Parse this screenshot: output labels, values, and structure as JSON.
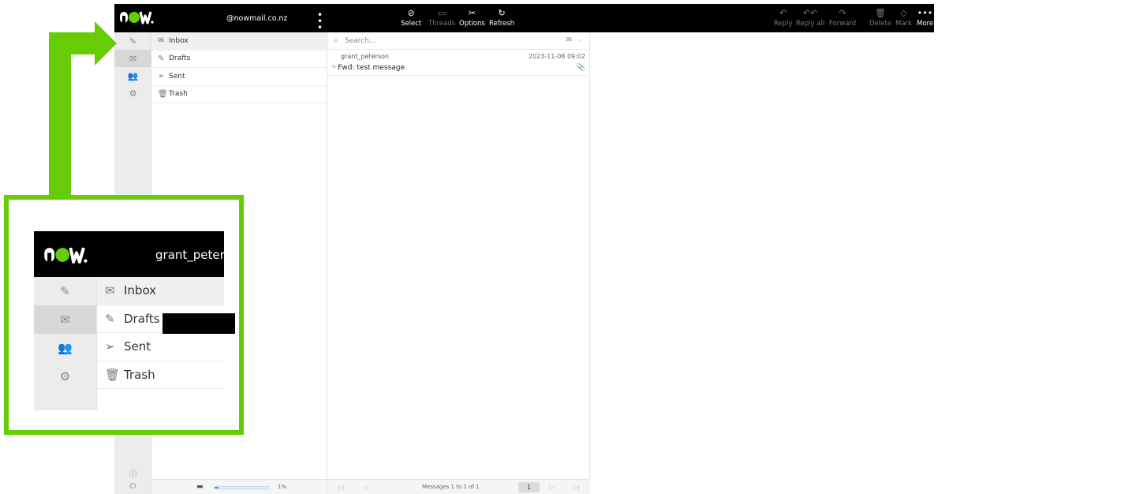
{
  "header": {
    "logo_text": "now.",
    "account_label": "@nowmail.co.nz",
    "more_menu_glyph": "⋮"
  },
  "toolbar_left": [
    {
      "id": "select",
      "label": "Select",
      "icon": "check-circle-icon",
      "enabled": true
    },
    {
      "id": "threads",
      "label": "Threads",
      "icon": "threads-icon",
      "enabled": false
    },
    {
      "id": "options",
      "label": "Options",
      "icon": "options-icon",
      "enabled": true
    },
    {
      "id": "refresh",
      "label": "Refresh",
      "icon": "refresh-icon",
      "enabled": true
    }
  ],
  "toolbar_right": [
    {
      "id": "reply",
      "label": "Reply",
      "icon": "reply-icon",
      "enabled": false
    },
    {
      "id": "reply_all",
      "label": "Reply all",
      "icon": "reply-all-icon",
      "enabled": false
    },
    {
      "id": "forward",
      "label": "Forward",
      "icon": "forward-icon",
      "enabled": false
    },
    {
      "id": "delete",
      "label": "Delete",
      "icon": "trash-icon",
      "enabled": false
    },
    {
      "id": "mark",
      "label": "Mark",
      "icon": "tag-icon",
      "enabled": false
    },
    {
      "id": "more",
      "label": "More",
      "icon": "more-icon",
      "enabled": true
    }
  ],
  "folders": [
    {
      "name": "Inbox",
      "icon": "envelope-icon",
      "active": true
    },
    {
      "name": "Drafts",
      "icon": "compose-icon",
      "active": false
    },
    {
      "name": "Sent",
      "icon": "paper-plane-icon",
      "active": false
    },
    {
      "name": "Trash",
      "icon": "trash-icon",
      "active": false
    }
  ],
  "search": {
    "placeholder": "Search..."
  },
  "messages": [
    {
      "from": "grant_peterson",
      "date": "2023-11-08 09:02",
      "subject": "Fwd: test message",
      "forwarded": true,
      "has_attachment": true
    }
  ],
  "quota": {
    "percent": 1,
    "label": "1%"
  },
  "pager": {
    "text": "Messages 1 to 1 of 1",
    "page": "1"
  },
  "zoom_callout": {
    "username": "grant_peterso",
    "folders": [
      "Inbox",
      "Drafts",
      "Sent",
      "Trash"
    ]
  },
  "colors": {
    "accent_green": "#65cc06",
    "topbar": "#000000",
    "quota_fill": "#4a90e2"
  }
}
